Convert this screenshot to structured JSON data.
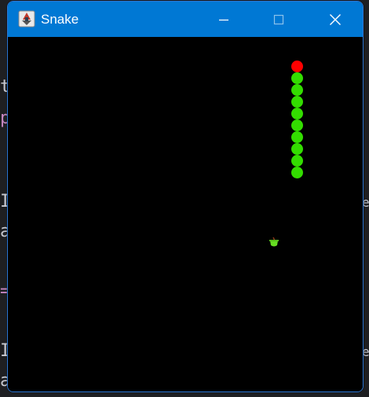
{
  "window": {
    "title": "Snake",
    "minimize_label": "Minimize",
    "maximize_label": "Maximize",
    "close_label": "Close"
  },
  "colors": {
    "titlebar": "#0078d4",
    "board": "#000000",
    "snake_head": "#ff0000",
    "snake_body": "#33dd00",
    "apple": "#66dd22"
  },
  "game": {
    "snake_length": 10,
    "head_direction": "up",
    "apple_icon": "apple-icon"
  }
}
